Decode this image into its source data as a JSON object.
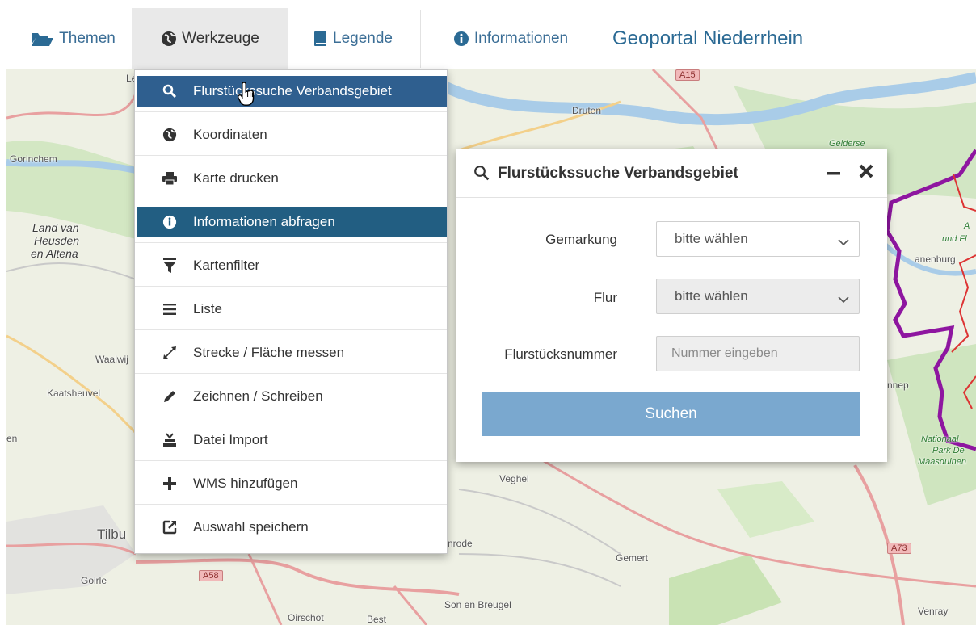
{
  "navbar": {
    "themen_label": "Themen",
    "werkzeuge_label": "Werkzeuge",
    "legende_label": "Legende",
    "informationen_label": "Informationen",
    "brand_title": "Geoportal Niederrhein"
  },
  "tools_menu": {
    "items": [
      {
        "label": "Flurstückssuche Verbandsgebiet",
        "icon": "search-icon",
        "state": "hover"
      },
      {
        "label": "Koordinaten",
        "icon": "globe-icon"
      },
      {
        "label": "Karte drucken",
        "icon": "printer-icon"
      },
      {
        "label": "Informationen abfragen",
        "icon": "info-icon",
        "state": "active"
      },
      {
        "label": "Kartenfilter",
        "icon": "filter-icon"
      },
      {
        "label": "Liste",
        "icon": "list-icon"
      },
      {
        "label": "Strecke / Fläche messen",
        "icon": "measure-icon"
      },
      {
        "label": "Zeichnen / Schreiben",
        "icon": "pencil-icon"
      },
      {
        "label": "Datei Import",
        "icon": "import-icon"
      },
      {
        "label": "WMS hinzufügen",
        "icon": "plus-icon"
      },
      {
        "label": "Auswahl speichern",
        "icon": "share-icon"
      }
    ]
  },
  "search_panel": {
    "title": "Flurstückssuche Verbandsgebiet",
    "gemarkung_label": "Gemarkung",
    "gemarkung_value": "bitte wählen",
    "flur_label": "Flur",
    "flur_value": "bitte wählen",
    "nummer_label": "Flurstücksnummer",
    "nummer_placeholder": "Nummer eingeben",
    "search_button": "Suchen"
  },
  "map_labels": {
    "gorinchem": "Gorinchem",
    "land_van_heusden_1": "Land van",
    "land_van_heusden_2": "Heusden",
    "land_van_heusden_3": "en Altena",
    "waalwijk": "Waalwij",
    "kaatsheuvel": "Kaatsheuvel",
    "tilburg": "Tilbu",
    "goirle": "Goirle",
    "oirschot": "Oirschot",
    "best": "Best",
    "son_en_breugel": "Son en Breugel",
    "druten": "Druten",
    "veghel": "Veghel",
    "erp": "nrode",
    "gemert": "Gemert",
    "venray": "Venray",
    "gelderse": "Gelderse",
    "und_fl": "und Fl",
    "gennep": "nnep",
    "ranenburg": "anenburg",
    "np_1": "Nationaal",
    "np_2": "Park De",
    "np_3": "Maasduinen",
    "en": "en",
    "l_top": "Le",
    "a_small": "A",
    "a15": "A15",
    "a58": "A58",
    "a73": "A73"
  },
  "colors": {
    "accent": "#2b6a94",
    "menu_hover": "#2f5f8f",
    "menu_active": "#225e82",
    "search_button": "#7aa8cf",
    "boundary_purple": "#8e16a0"
  }
}
